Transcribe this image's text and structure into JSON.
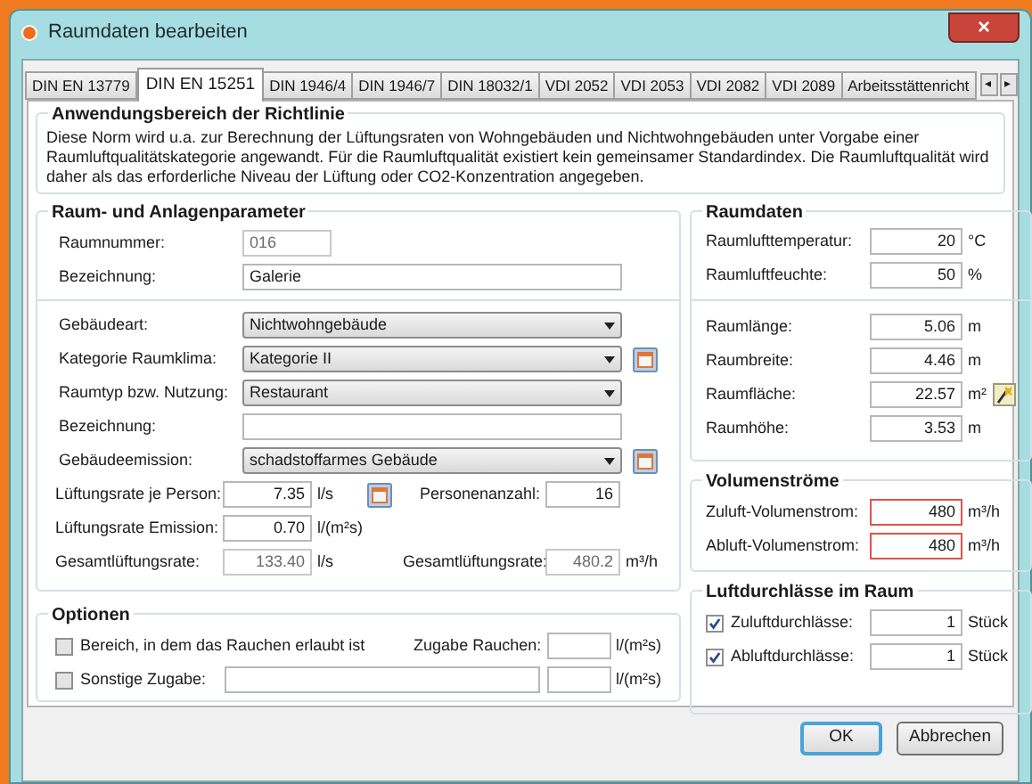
{
  "window": {
    "title": "Raumdaten bearbeiten",
    "close": "×"
  },
  "tabs": [
    {
      "label": "DIN EN 13779",
      "selected": false
    },
    {
      "label": "DIN EN 15251",
      "selected": true
    },
    {
      "label": "DIN 1946/4",
      "selected": false
    },
    {
      "label": "DIN 1946/7",
      "selected": false
    },
    {
      "label": "DIN 18032/1",
      "selected": false
    },
    {
      "label": "VDI 2052",
      "selected": false
    },
    {
      "label": "VDI 2053",
      "selected": false
    },
    {
      "label": "VDI 2082",
      "selected": false
    },
    {
      "label": "VDI 2089",
      "selected": false
    },
    {
      "label": "Arbeitsstättenricht",
      "selected": false
    }
  ],
  "tab_scroll": [
    "◂",
    "▸"
  ],
  "scope": {
    "title": "Anwendungsbereich der Richtlinie",
    "text": "Diese  Norm wird u.a. zur Berechnung der Lüftungsraten von Wohngebäuden und Nichtwohngebäuden unter Vorgabe einer Raumluftqualitätskategorie angewandt. Für die Raumluftqualität existiert kein gemeinsamer Standardindex. Die Raumluftqualität wird daher als das erforderliche Niveau der Lüftung oder CO2-Konzentration angegeben."
  },
  "room_params": {
    "title": "Raum- und Anlagenparameter",
    "identity": [
      {
        "label": "Raumnummer:",
        "value": "016",
        "readonly": true
      },
      {
        "label": "Bezeichnung:",
        "value": "Galerie",
        "readonly": false
      }
    ],
    "settings": [
      {
        "kind": "select",
        "label": "Gebäudeart:",
        "value": "Nichtwohngebäude",
        "calc": false
      },
      {
        "kind": "select",
        "label": "Kategorie Raumklima:",
        "value": "Kategorie II",
        "calc": true
      },
      {
        "kind": "select",
        "label": "Raumtyp bzw. Nutzung:",
        "value": "Restaurant",
        "calc": false
      },
      {
        "kind": "text",
        "label": "Bezeichnung:",
        "calc": false
      },
      {
        "kind": "select",
        "label": "Gebäudeemission:",
        "value": "schadstoffarmes Gebäude",
        "calc": true
      }
    ],
    "rates": [
      {
        "label": "Lüftungsrate je Person:",
        "value": "7.35",
        "unit": "l/s",
        "readonly": false,
        "calc": true,
        "right": {
          "label": "Personenanzahl:",
          "value": "16",
          "readonly": false
        }
      },
      {
        "label": "Lüftungsrate Emission:",
        "value": "0.70",
        "unit": "l/(m²s)",
        "readonly": false,
        "calc": false
      },
      {
        "label": "Gesamtlüftungsrate:",
        "value": "133.40",
        "unit": "l/s",
        "readonly": true,
        "calc": false,
        "right": {
          "label": "Gesamtlüftungsrate:",
          "value": "480.2",
          "unit": "m³/h",
          "readonly": true
        }
      }
    ]
  },
  "options": {
    "title": "Optionen",
    "rows": [
      {
        "label": "Bereich, in dem das Rauchen erlaubt ist",
        "checked": false,
        "field_label": "Zugabe Rauchen:",
        "unit": "l/(m²s)"
      },
      {
        "label": "Sonstige Zugabe:",
        "checked": false,
        "unit": "l/(m²s)"
      }
    ]
  },
  "room_data": {
    "title": "Raumdaten",
    "groups": [
      [
        {
          "label": "Raumlufttemperatur:",
          "value": "20",
          "unit": "°C",
          "calc": false
        },
        {
          "label": "Raumluftfeuchte:",
          "value": "50",
          "unit": "%",
          "calc": false
        }
      ],
      [
        {
          "label": "Raumlänge:",
          "value": "5.06",
          "unit": "m",
          "calc": false
        },
        {
          "label": "Raumbreite:",
          "value": "4.46",
          "unit": "m",
          "calc": false
        },
        {
          "label": "Raumfläche:",
          "value": "22.57",
          "unit": "m²",
          "calc": true
        },
        {
          "label": "Raumhöhe:",
          "value": "3.53",
          "unit": "m",
          "calc": false
        }
      ]
    ]
  },
  "volume_flows": {
    "title": "Volumenströme",
    "rows": [
      {
        "label": "Zuluft-Volumenstrom:",
        "value": "480",
        "unit": "m³/h",
        "error": true
      },
      {
        "label": "Abluft-Volumenstrom:",
        "value": "480",
        "unit": "m³/h",
        "error": true
      }
    ]
  },
  "outlets": {
    "title": "Luftdurchlässe im Raum",
    "rows": [
      {
        "label": "Zuluftdurchlässe:",
        "checked": true,
        "value": "1",
        "unit": "Stück"
      },
      {
        "label": "Abluftdurchlässe:",
        "checked": true,
        "value": "1",
        "unit": "Stück"
      }
    ]
  },
  "buttons": [
    {
      "label": "OK",
      "default": true
    },
    {
      "label": "Abbrechen",
      "default": false
    }
  ]
}
